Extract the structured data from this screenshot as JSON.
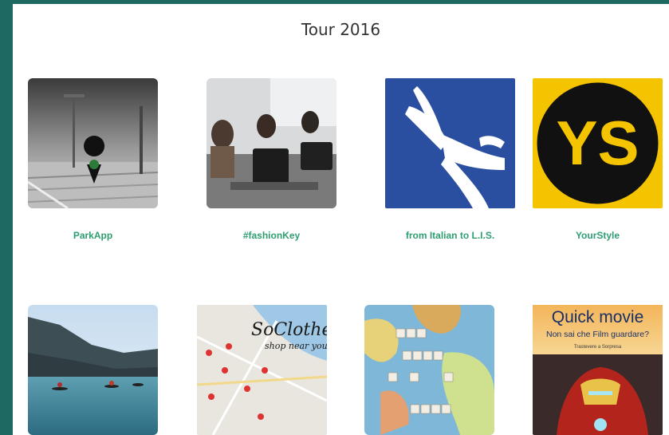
{
  "page": {
    "title": "Tour 2016"
  },
  "projects": [
    {
      "label": "ParkApp",
      "icon": "parking-pin-photo-icon"
    },
    {
      "label": "#fashionKey",
      "icon": "classroom-photo-icon"
    },
    {
      "label": "from Italian to L.I.S.",
      "icon": "sign-language-hands-icon"
    },
    {
      "label": "YourStyle",
      "icon": "ys-logo-icon",
      "logo_text": "YS"
    },
    {
      "label": "",
      "icon": "kayak-lake-photo-icon"
    },
    {
      "label": "",
      "icon": "soclothes-map-icon",
      "logo_text": "SoClothes",
      "tagline": "shop near you"
    },
    {
      "label": "",
      "icon": "world-map-tiles-icon"
    },
    {
      "label": "",
      "icon": "quick-movie-poster-icon",
      "logo_text": "Quick movie",
      "tagline": "Non sai che Film guardare?",
      "subtagline": "Trastevere a Sorpresa"
    }
  ],
  "colors": {
    "background": "#1e6a62",
    "label_green": "#2e9e72",
    "lis_blue": "#2a4fa0",
    "ys_yellow": "#f5c400"
  }
}
